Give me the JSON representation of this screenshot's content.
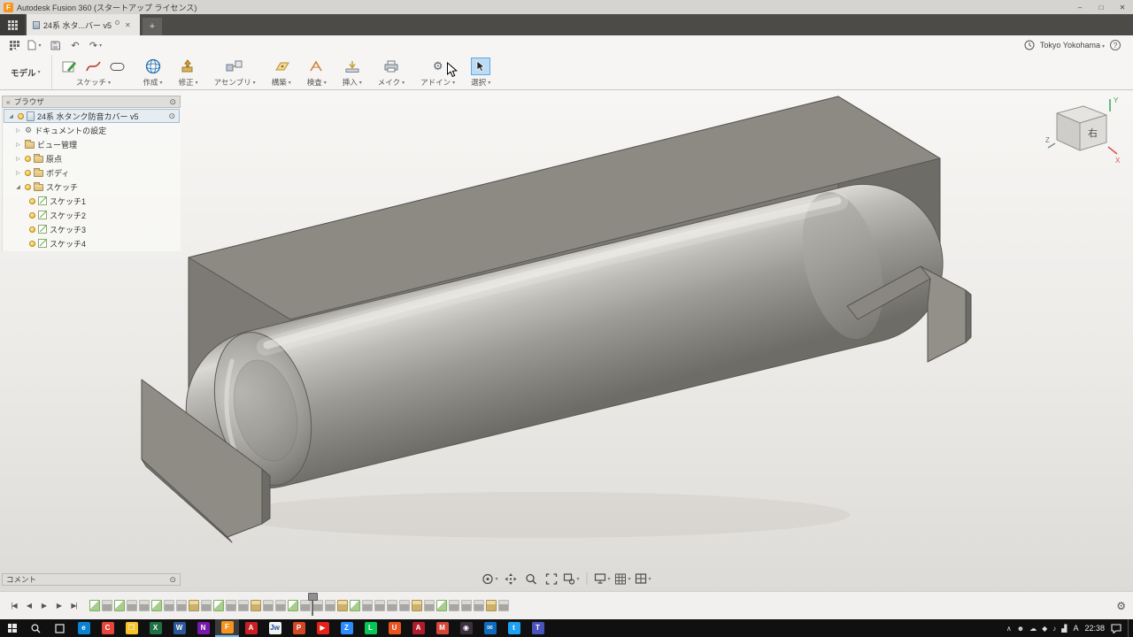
{
  "colors": {
    "fusion_orange": "#f7941e",
    "accent_blue": "#0696d7",
    "select_highlight": "#bcdcf5"
  },
  "titlebar": {
    "app_initial": "F",
    "title": "Autodesk Fusion 360 (スタートアップ ライセンス)",
    "minimize": "–",
    "maximize": "□",
    "close": "✕"
  },
  "tabbar": {
    "active_tab": {
      "label": "24系  水タ...バー v5",
      "close": "✕"
    },
    "new_tab": "+"
  },
  "toolbar": {
    "undo": "↶",
    "redo": "↷",
    "account": "Tokyo Yokohama",
    "help": "?"
  },
  "ribbon": {
    "workspace_label": "モデル",
    "groups": {
      "sketch": "スケッチ",
      "create": "作成",
      "modify": "修正",
      "assemble": "アセンブリ",
      "construct": "構築",
      "inspect": "検査",
      "insert": "挿入",
      "make": "メイク",
      "addins": "アドイン",
      "select": "選択"
    }
  },
  "browser": {
    "header": "ブラウザ",
    "root_label": "24系  水タンク防音カバー v5",
    "nodes": [
      {
        "label": "ドキュメントの設定"
      },
      {
        "label": "ビュー管理"
      },
      {
        "label": "原点"
      },
      {
        "label": "ボディ"
      },
      {
        "label": "スケッチ"
      }
    ],
    "sketches": [
      {
        "label": "スケッチ1"
      },
      {
        "label": "スケッチ2"
      },
      {
        "label": "スケッチ3"
      },
      {
        "label": "スケッチ4"
      }
    ]
  },
  "viewcube": {
    "face_label": "右",
    "axis_x": "X",
    "axis_y": "Y",
    "axis_z": "Z"
  },
  "comments": {
    "header": "コメント"
  },
  "timeline": {
    "controls": [
      {
        "name": "go-to-start",
        "glyph": "|◀"
      },
      {
        "name": "step-back",
        "glyph": "◀"
      },
      {
        "name": "play",
        "glyph": "▶"
      },
      {
        "name": "step-forward",
        "glyph": "▶"
      },
      {
        "name": "go-to-end",
        "glyph": "▶|"
      }
    ],
    "settings_gear": "⚙",
    "features": [
      "sketch",
      "extrude",
      "sketch",
      "extrude",
      "extrude",
      "sketch",
      "extrude",
      "extrude",
      "mod",
      "extrude",
      "sketch",
      "extrude",
      "extrude",
      "mod",
      "extrude",
      "extrude",
      "sketch",
      "extrude",
      "extrude",
      "extrude",
      "mod",
      "sketch",
      "extrude",
      "extrude",
      "extrude",
      "extrude",
      "mod",
      "extrude",
      "sketch",
      "extrude",
      "extrude",
      "extrude",
      "mod",
      "extrude"
    ]
  },
  "taskbar": {
    "apps": [
      {
        "name": "edge",
        "label": "e",
        "color": "#0a84d0"
      },
      {
        "name": "chrome",
        "label": "C",
        "color": "#e8453c"
      },
      {
        "name": "file-explorer",
        "label": "❐",
        "color": "#f8c32c"
      },
      {
        "name": "excel",
        "label": "X",
        "color": "#1e7145"
      },
      {
        "name": "word",
        "label": "W",
        "color": "#2b579a"
      },
      {
        "name": "onenote",
        "label": "N",
        "color": "#7719aa"
      },
      {
        "name": "fusion-360",
        "label": "F",
        "color": "#f7941e",
        "active": true
      },
      {
        "name": "acrobat",
        "label": "A",
        "color": "#c81f25"
      },
      {
        "name": "jw-cad",
        "label": "Jw",
        "color": "#f2f2f2",
        "fg": "#1a4fa0"
      },
      {
        "name": "powerpoint",
        "label": "P",
        "color": "#d24726"
      },
      {
        "name": "youtube",
        "label": "▶",
        "color": "#e62117"
      },
      {
        "name": "zoom",
        "label": "Z",
        "color": "#2d8cff"
      },
      {
        "name": "line",
        "label": "L",
        "color": "#06c755"
      },
      {
        "name": "ubuntu",
        "label": "U",
        "color": "#e95420"
      },
      {
        "name": "autocad",
        "label": "A",
        "color": "#b01c2e"
      },
      {
        "name": "gmail",
        "label": "M",
        "color": "#d44638"
      },
      {
        "name": "instagram",
        "label": "◉",
        "color": "#3b2f3f"
      },
      {
        "name": "mail",
        "label": "✉",
        "color": "#0f6cbd"
      },
      {
        "name": "twitter",
        "label": "t",
        "color": "#1da1f2"
      },
      {
        "name": "teams",
        "label": "T",
        "color": "#4b53bc"
      }
    ],
    "tray_icons": [
      {
        "name": "hidden-icons-expander",
        "glyph": "∧"
      },
      {
        "name": "people",
        "glyph": "☻"
      },
      {
        "name": "onedrive-cloud",
        "glyph": "☁"
      },
      {
        "name": "security-shield",
        "glyph": "◆"
      },
      {
        "name": "volume",
        "glyph": "♪"
      },
      {
        "name": "network-signal",
        "glyph": "▟"
      }
    ],
    "ime": "A",
    "time": "22:38"
  }
}
